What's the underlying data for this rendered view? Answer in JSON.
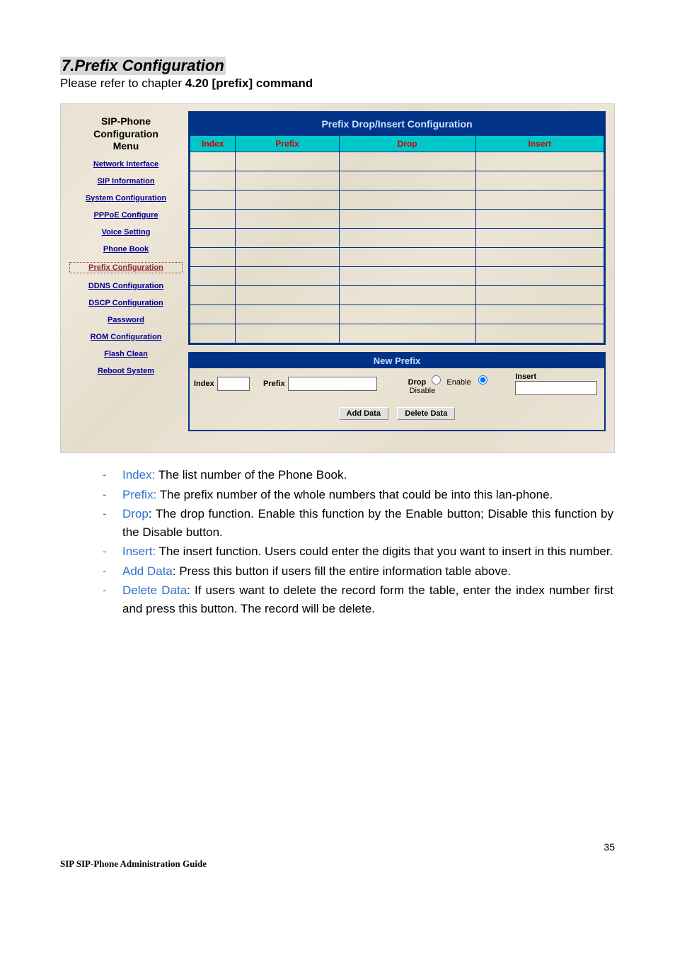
{
  "heading": "7.Prefix Configuration",
  "intro_plain": "Please refer to chapter ",
  "intro_bold": "4.20 [prefix] command",
  "sidebar": {
    "title_l1": "SIP-Phone",
    "title_l2": "Configuration",
    "title_l3": "Menu",
    "items": [
      "Network Interface",
      "SIP Information",
      "System Configuration",
      "PPPoE Configure",
      "Voice Setting",
      "Phone Book",
      "Prefix Configuration",
      "DDNS Configuration",
      "DSCP Configuration",
      "Password",
      "ROM Configuration",
      "Flash Clean",
      "Reboot System"
    ],
    "current_index": 6
  },
  "panel": {
    "title": "Prefix Drop/Insert Configuration",
    "columns": {
      "index": "Index",
      "prefix": "Prefix",
      "drop": "Drop",
      "insert": "Insert"
    },
    "row_count": 10
  },
  "newprefix": {
    "title": "New Prefix",
    "labels": {
      "index": "Index",
      "prefix": "Prefix",
      "drop": "Drop",
      "enable": "Enable",
      "disable": "Disable",
      "insert": "Insert"
    },
    "buttons": {
      "add": "Add Data",
      "delete": "Delete Data"
    },
    "drop_selected": "disable"
  },
  "desc": [
    {
      "term": "Index:",
      "text": " The list number of the Phone Book."
    },
    {
      "term": "Prefix:",
      "text": " The prefix number of the whole numbers that could be into this lan-phone."
    },
    {
      "term": "Drop",
      "colon": ":",
      "text": " The drop function. Enable this function by the Enable button; Disable this function by the Disable button."
    },
    {
      "term": "Insert:",
      "text": " The insert function. Users could enter the digits that you want to insert in this number."
    },
    {
      "term": "Add Data",
      "colon": ":",
      "text": " Press this button if users fill the entire information table above."
    },
    {
      "term": "Delete Data",
      "colon": ":",
      "text": " If users want to delete the record form the table, enter the index number first and press this button. The record will be delete."
    }
  ],
  "pagenum": "35",
  "footer": "SIP SIP-Phone    Administration Guide"
}
